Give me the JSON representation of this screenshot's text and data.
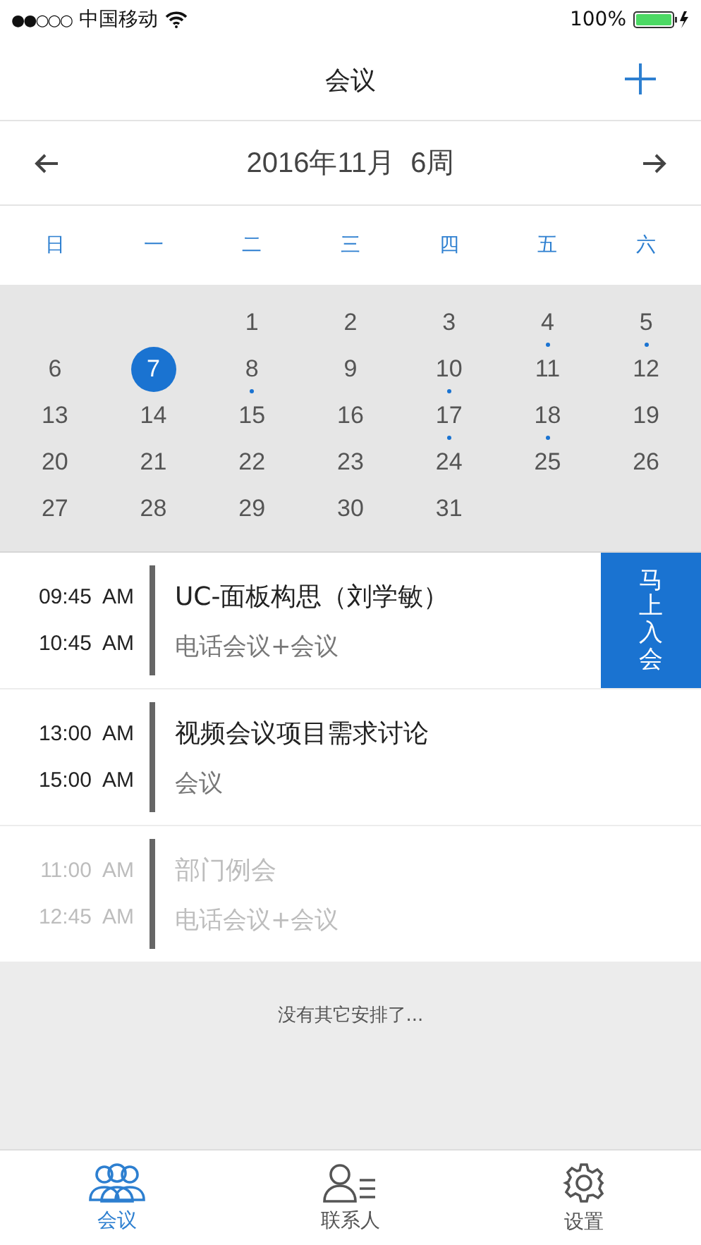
{
  "status_bar": {
    "signal": "●●○○○",
    "carrier": "中国移动",
    "battery": "100%"
  },
  "nav": {
    "title": "会议"
  },
  "period": {
    "label": "2016年11月  6周"
  },
  "weekdays": [
    "日",
    "一",
    "二",
    "三",
    "四",
    "五",
    "六"
  ],
  "weeks": [
    {
      "days": [
        {
          "day": "1",
          "dot": false,
          "selected": false
        },
        {
          "day": "2",
          "dot": false,
          "selected": false
        },
        {
          "day": "3",
          "dot": false,
          "selected": false
        },
        {
          "day": "4",
          "dot": true,
          "selected": false
        },
        {
          "day": "5",
          "dot": true,
          "selected": false
        }
      ]
    },
    {
      "days": [
        {
          "day": "6",
          "dot": false,
          "selected": false
        },
        {
          "day": "7",
          "dot": false,
          "selected": true
        },
        {
          "day": "8",
          "dot": true,
          "selected": false
        },
        {
          "day": "9",
          "dot": false,
          "selected": false
        },
        {
          "day": "10",
          "dot": true,
          "selected": false
        },
        {
          "day": "11",
          "dot": false,
          "selected": false
        },
        {
          "day": "12",
          "dot": false,
          "selected": false
        }
      ]
    },
    {
      "days": [
        {
          "day": "13",
          "dot": false,
          "selected": false
        },
        {
          "day": "14",
          "dot": false,
          "selected": false
        },
        {
          "day": "15",
          "dot": false,
          "selected": false
        },
        {
          "day": "16",
          "dot": false,
          "selected": false
        },
        {
          "day": "17",
          "dot": true,
          "selected": false
        },
        {
          "day": "18",
          "dot": true,
          "selected": false
        },
        {
          "day": "19",
          "dot": false,
          "selected": false
        }
      ]
    },
    {
      "days": [
        {
          "day": "20",
          "dot": false,
          "selected": false
        },
        {
          "day": "21",
          "dot": false,
          "selected": false
        },
        {
          "day": "22",
          "dot": false,
          "selected": false
        },
        {
          "day": "23",
          "dot": false,
          "selected": false
        },
        {
          "day": "24",
          "dot": false,
          "selected": false
        },
        {
          "day": "25",
          "dot": false,
          "selected": false
        },
        {
          "day": "26",
          "dot": false,
          "selected": false
        }
      ]
    },
    {
      "days": [
        {
          "day": "27",
          "dot": false,
          "selected": false
        },
        {
          "day": "28",
          "dot": false,
          "selected": false
        },
        {
          "day": "29",
          "dot": false,
          "selected": false
        },
        {
          "day": "30",
          "dot": false,
          "selected": false
        },
        {
          "day": "31",
          "dot": false,
          "selected": false
        }
      ]
    }
  ],
  "events": [
    {
      "start": "09:45  AM",
      "end": "10:45  AM",
      "title": "UC-面板构思（刘学敏）",
      "subtitle": "电话会议+会议",
      "past": false,
      "action": "马上入会"
    },
    {
      "start": "13:00  AM",
      "end": "15:00  AM",
      "title": "视频会议项目需求讨论",
      "subtitle": "会议",
      "past": false
    },
    {
      "start": "11:00  AM",
      "end": "12:45  AM",
      "title": "部门例会",
      "subtitle": "电话会议+会议",
      "past": true
    }
  ],
  "empty_note": "没有其它安排了...",
  "tabs": [
    {
      "label": "会议",
      "kind": "meetings",
      "selected": true
    },
    {
      "label": "联系人",
      "kind": "contacts",
      "selected": false
    },
    {
      "label": "设置",
      "kind": "settings",
      "selected": false
    }
  ]
}
